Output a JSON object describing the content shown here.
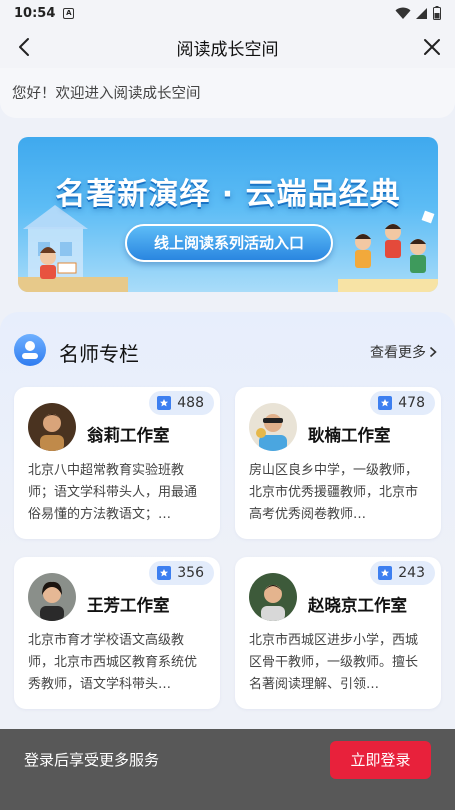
{
  "status_bar": {
    "time": "10:54"
  },
  "nav": {
    "title": "阅读成长空间"
  },
  "greeting": "您好！欢迎进入阅读成长空间",
  "banner": {
    "title": "名著新演绎 · 云端品经典",
    "button_label": "线上阅读系列活动入口"
  },
  "section": {
    "title": "名师专栏",
    "more_label": "查看更多"
  },
  "teachers": [
    {
      "name": "翁莉工作室",
      "count": "488",
      "desc": "北京八中超常教育实验班教师；语文学科带头人，用最通俗易懂的方法教语文；…"
    },
    {
      "name": "耿楠工作室",
      "count": "478",
      "desc": "房山区良乡中学，一级教师，北京市优秀援疆教师，北京市高考优秀阅卷教师…"
    },
    {
      "name": "王芳工作室",
      "count": "356",
      "desc": "北京市育才学校语文高级教师，北京市西城区教育系统优秀教师，语文学科带头…"
    },
    {
      "name": "赵晓京工作室",
      "count": "243",
      "desc": "北京市西城区进步小学，西城区骨干教师，一级教师。擅长名著阅读理解、引领…"
    }
  ],
  "bottom_bar": {
    "text": "登录后享受更多服务",
    "login_label": "立即登录"
  },
  "colors": {
    "accent": "#e8213b",
    "banner_blue": "#3fa9ee",
    "badge_bg": "#e3ecfb",
    "bottom_bar": "#585858"
  }
}
